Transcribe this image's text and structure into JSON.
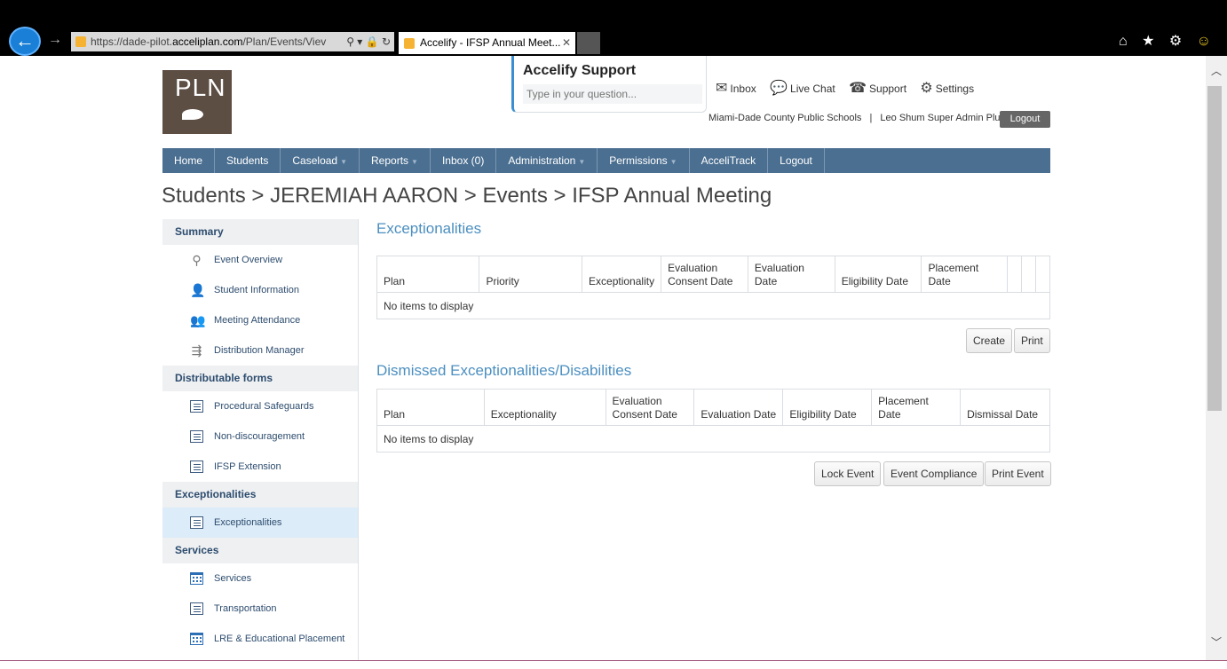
{
  "browser": {
    "url_prefix": "https://dade-pilot.",
    "url_domain": "acceliplan.com",
    "url_suffix": "/Plan/Events/Viev",
    "tab_title": "Accelify - IFSP Annual Meet...",
    "tab_close": "✕",
    "back": "←",
    "forward": "→",
    "address_controls": "⚲ ▾ 🔒 ↻",
    "toolbar_icons": "⌂ ★ ⚙"
  },
  "header": {
    "logo_text": "PLN",
    "support": {
      "title": "Accelify Support",
      "placeholder": "Type in your question..."
    },
    "links": [
      {
        "icon": "envelope-icon",
        "glyph": "✉",
        "label": "Inbox"
      },
      {
        "icon": "chat-icon",
        "glyph": "💬",
        "label": "Live Chat"
      },
      {
        "icon": "phone-icon",
        "glyph": "☎",
        "label": "Support"
      },
      {
        "icon": "gear-icon",
        "glyph": "⚙",
        "label": "Settings"
      }
    ],
    "organization": "Miami-Dade County Public Schools",
    "separator": "|",
    "user": "Leo Shum Super Admin Plus",
    "logout": "Logout"
  },
  "nav": [
    {
      "label": "Home",
      "dropdown": false
    },
    {
      "label": "Students",
      "dropdown": false
    },
    {
      "label": "Caseload",
      "dropdown": true
    },
    {
      "label": "Reports",
      "dropdown": true
    },
    {
      "label": "Inbox (0)",
      "dropdown": false
    },
    {
      "label": "Administration",
      "dropdown": true
    },
    {
      "label": "Permissions",
      "dropdown": true
    },
    {
      "label": "AcceliTrack",
      "dropdown": false
    },
    {
      "label": "Logout",
      "dropdown": false
    }
  ],
  "breadcrumb": "Students > JEREMIAH AARON > Events > IFSP Annual Meeting",
  "sidebar": {
    "summary": "Summary",
    "summary_items": [
      "Event Overview",
      "Student Information",
      "Meeting Attendance",
      "Distribution Manager"
    ],
    "forms": "Distributable forms",
    "forms_items": [
      "Procedural Safeguards",
      "Non-discouragement",
      "IFSP Extension"
    ],
    "exceptionalities": "Exceptionalities",
    "exceptionalities_items": [
      "Exceptionalities"
    ],
    "services": "Services",
    "services_items": [
      "Services",
      "Transportation",
      "LRE & Educational Placement"
    ]
  },
  "exceptionalities": {
    "title": "Exceptionalities",
    "columns": [
      "Plan",
      "Priority",
      "Exceptionality",
      "Evaluation Consent Date",
      "Evaluation Date",
      "Eligibility Date",
      "Placement Date"
    ],
    "empty": "No items to display",
    "create": "Create",
    "print": "Print"
  },
  "dismissed": {
    "title": "Dismissed Exceptionalities/Disabilities",
    "columns": [
      "Plan",
      "Exceptionality",
      "Evaluation Consent Date",
      "Evaluation Date",
      "Eligibility Date",
      "Placement Date",
      "Dismissal Date"
    ],
    "empty": "No items to display"
  },
  "actions": {
    "lock": "Lock Event",
    "compliance": "Event Compliance",
    "print_event": "Print Event"
  },
  "scroll": {
    "up": "︿",
    "down": "﹀"
  }
}
